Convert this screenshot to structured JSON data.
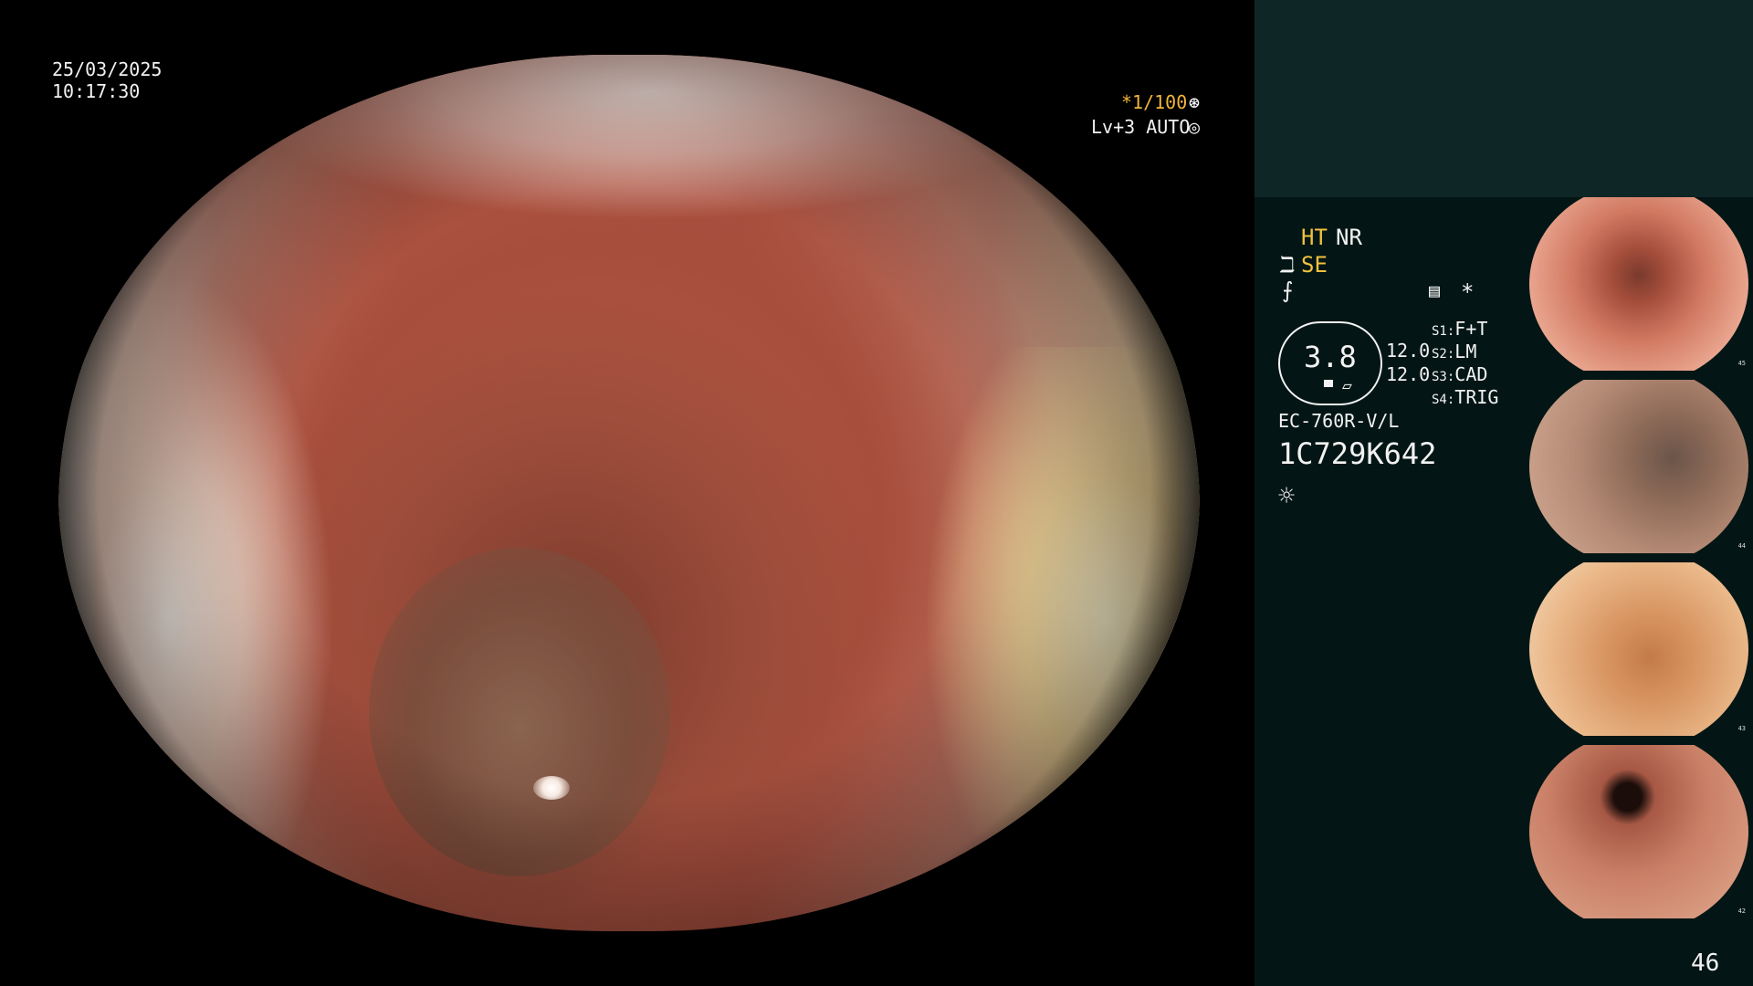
{
  "scope": {
    "date": "25/03/2025",
    "time": "10:17:30",
    "shutter": "*1/100",
    "shutter_icon": "⊛",
    "level": "Lv+3 AUTO",
    "level_icon": "◎"
  },
  "panel": {
    "ht": "HT",
    "nr": "NR",
    "se_icon": "ℶ",
    "se": "SE",
    "f_icon": "⨍",
    "mem_icon": "▤",
    "star": "*",
    "gauge_value": "3.8",
    "gauge_knob_icon": "▱",
    "value_1": "12.0",
    "value_2": "12.0",
    "switches": [
      {
        "key": "S1:",
        "value": "F+T"
      },
      {
        "key": "S2:",
        "value": "LM"
      },
      {
        "key": "S3:",
        "value": "CAD"
      },
      {
        "key": "S4:",
        "value": "TRIG"
      }
    ],
    "model": "EC-760R-V/L",
    "serial": "1C729K642",
    "light_icon": "☼",
    "page_number": "46"
  },
  "thumbnails": [
    {
      "num": "45"
    },
    {
      "num": "44"
    },
    {
      "num": "43"
    },
    {
      "num": "42"
    }
  ],
  "colors": {
    "accent_yellow": "#f0c040",
    "panel_bg": "#031615",
    "panel_top_bg": "#0e2626"
  }
}
